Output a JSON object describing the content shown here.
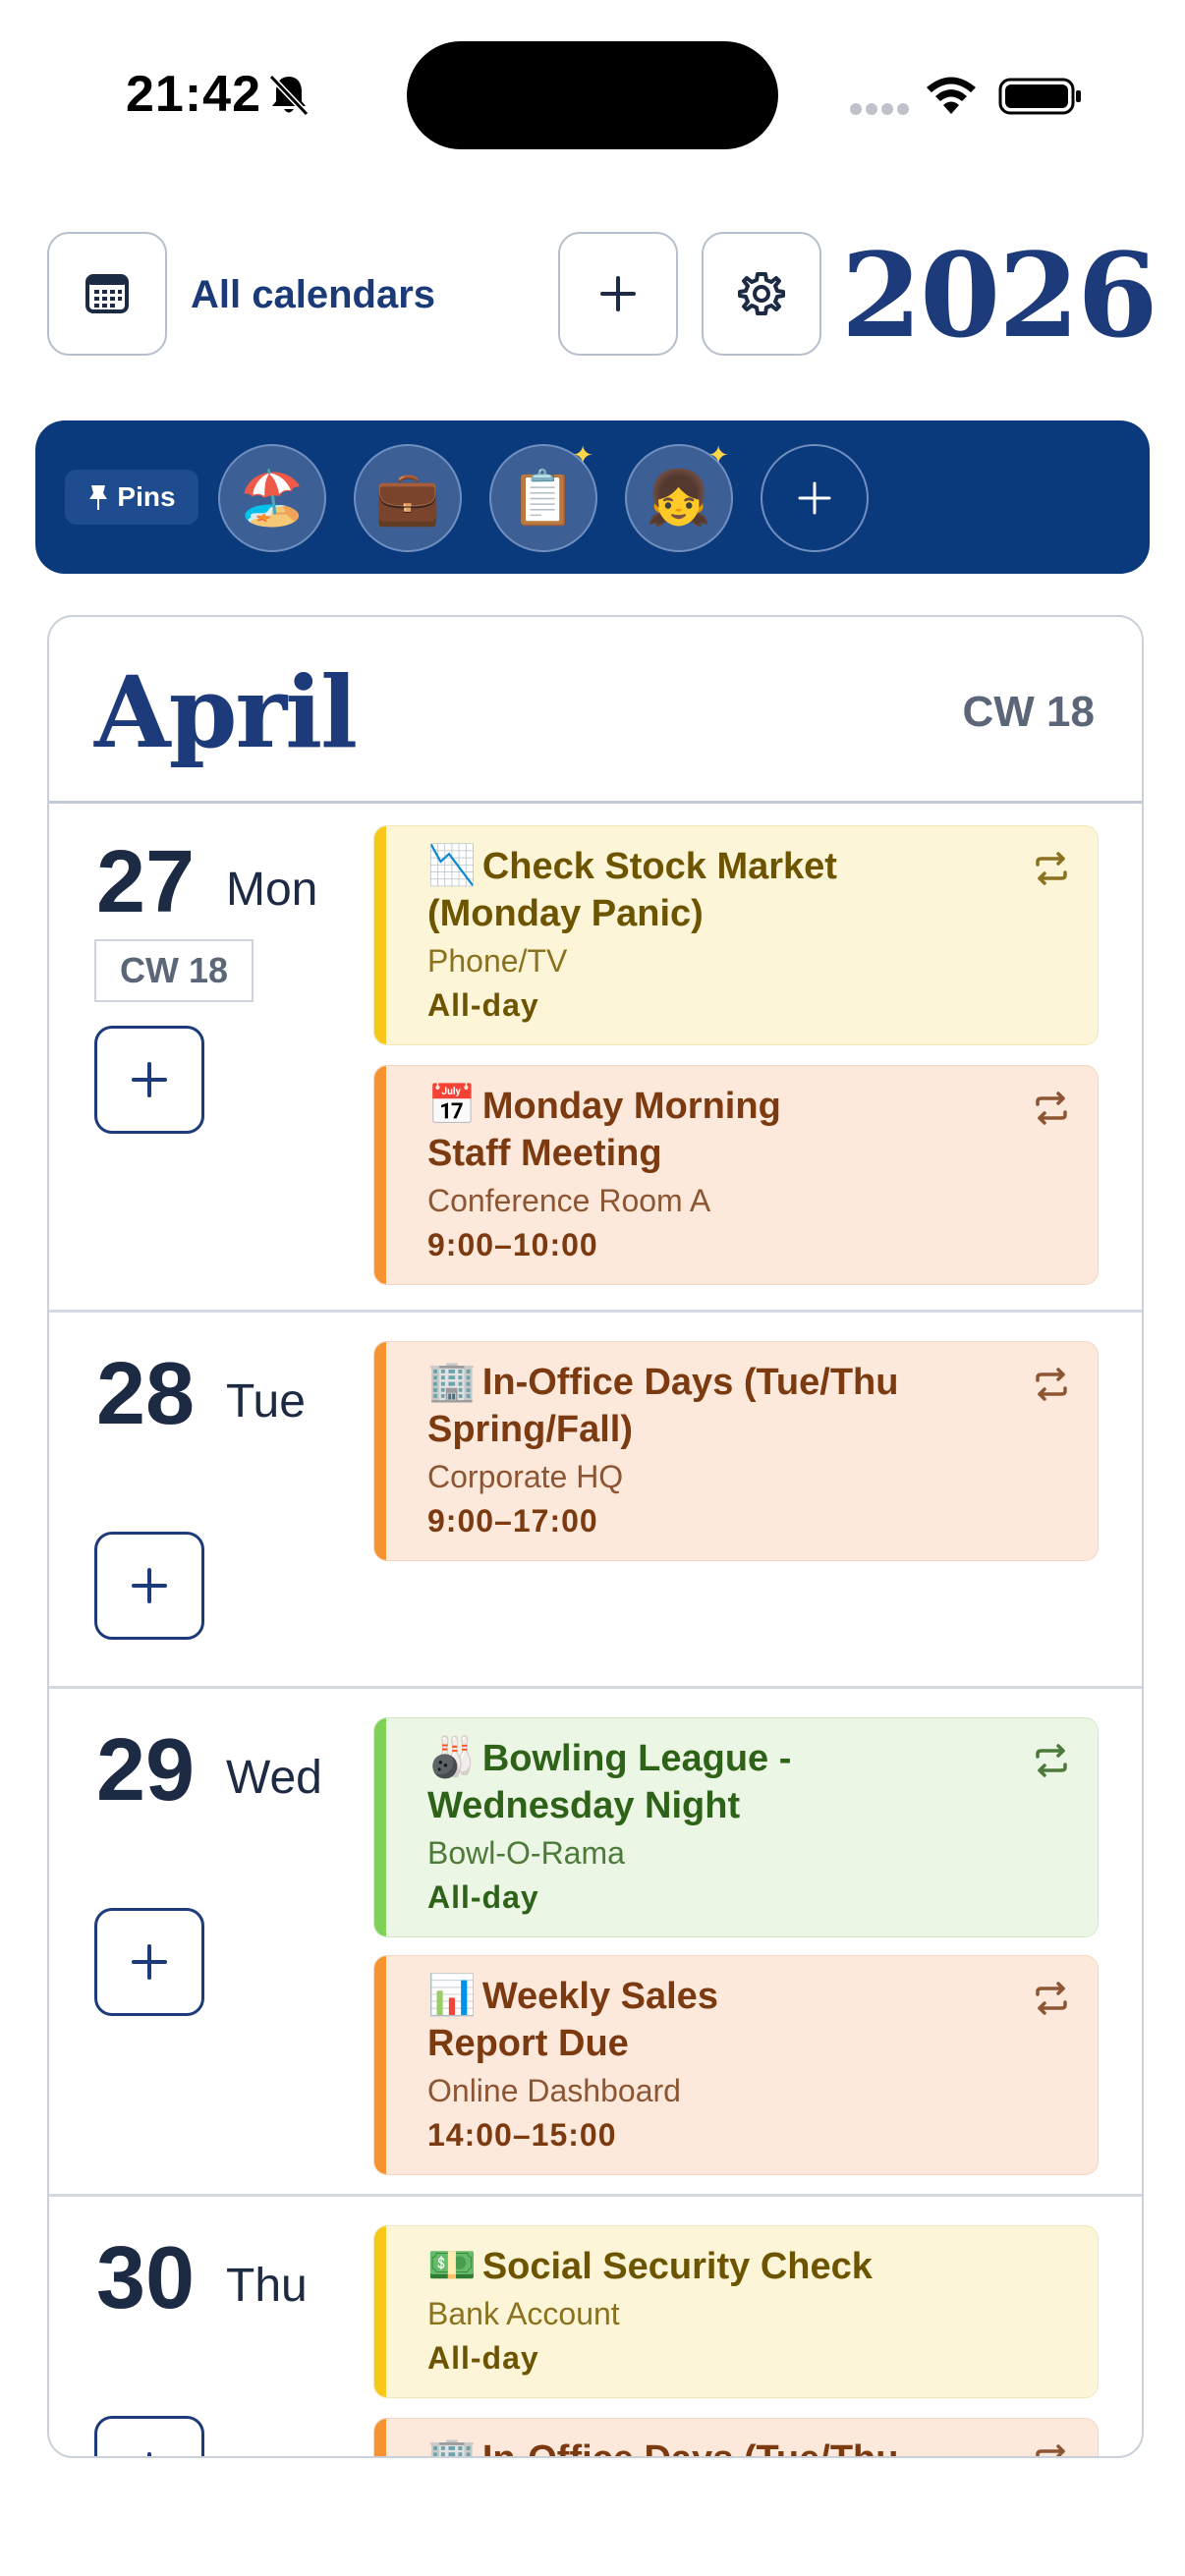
{
  "status_bar": {
    "time": "21:42"
  },
  "header": {
    "calendars_label": "All calendars",
    "year": "2026"
  },
  "pins": {
    "label": "Pins",
    "items": [
      {
        "emoji": "🏖️",
        "icon": "beach-icon"
      },
      {
        "emoji": "💼",
        "icon": "briefcase-icon"
      },
      {
        "emoji": "📋",
        "icon": "clipboard-icon"
      },
      {
        "emoji": "👧",
        "icon": "girl-icon"
      }
    ]
  },
  "month": {
    "name": "April",
    "cw": "CW 18"
  },
  "days": [
    {
      "num": "27",
      "name": "Mon",
      "cw": "CW 18",
      "events": [
        {
          "emoji": "📉",
          "title_line1": "Check Stock Market",
          "title_line2": "(Monday Panic)",
          "location": "Phone/TV",
          "time": "All-day",
          "color": "#f7c71a"
        },
        {
          "emoji": "📅",
          "title_line1": "Monday Morning",
          "title_line2": "Staff Meeting",
          "location": "Conference Room A",
          "time": "9:00–10:00",
          "color": "#f6922f"
        }
      ]
    },
    {
      "num": "28",
      "name": "Tue",
      "events": [
        {
          "emoji": "🏢",
          "title_line1": "In-Office Days (Tue/Thu",
          "title_line2": "Spring/Fall)",
          "location": "Corporate HQ",
          "time": "9:00–17:00",
          "color": "#f6922f"
        }
      ]
    },
    {
      "num": "29",
      "name": "Wed",
      "events": [
        {
          "emoji": "🎳",
          "title_line1": "Bowling League -",
          "title_line2": "Wednesday Night",
          "location": "Bowl-O-Rama",
          "time": "All-day",
          "color": "#7fd157"
        },
        {
          "emoji": "📊",
          "title_line1": "Weekly Sales",
          "title_line2": "Report Due",
          "location": "Online Dashboard",
          "time": "14:00–15:00",
          "color": "#f6922f"
        }
      ]
    },
    {
      "num": "30",
      "name": "Thu",
      "events": [
        {
          "emoji": "💵",
          "title_line1": "Social Security Check",
          "location": "Bank Account",
          "time": "All-day",
          "color": "#f7c71a"
        },
        {
          "emoji": "🏢",
          "title_line1": "In-Office Days (Tue/Thu",
          "color": "#f6922f"
        }
      ]
    }
  ]
}
